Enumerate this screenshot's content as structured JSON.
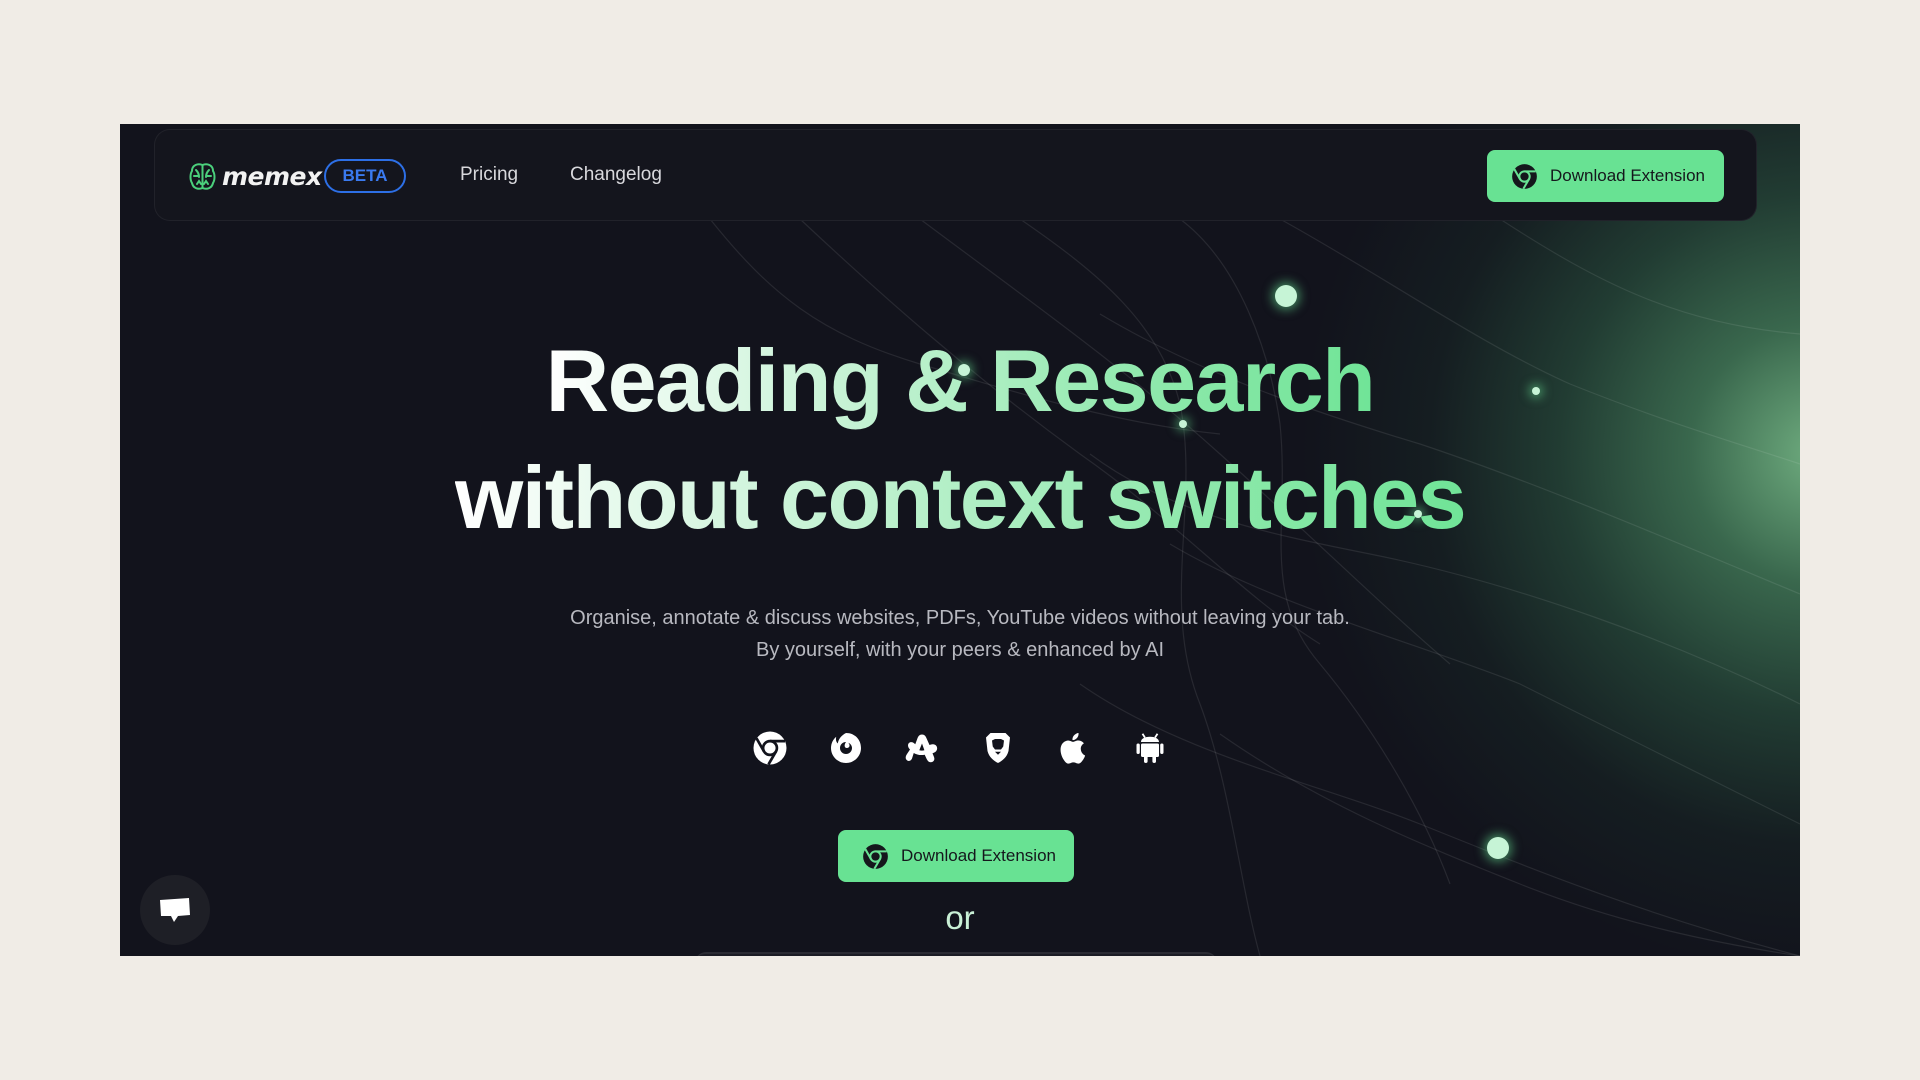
{
  "brand": {
    "name": "memex",
    "badge": "BETA",
    "accent": "#68e293",
    "badge_color": "#2d6fe6",
    "logo_icon": "brain-icon"
  },
  "nav": {
    "links": [
      {
        "label": "Pricing"
      },
      {
        "label": "Changelog"
      }
    ],
    "cta": {
      "label": "Download Extension",
      "icon": "chrome-icon"
    }
  },
  "hero": {
    "headline_line1": "Reading & Research",
    "headline_line2": "without context switches",
    "subtitle_line1": "Organise, annotate & discuss websites, PDFs, YouTube videos without leaving your tab.",
    "subtitle_line2": "By yourself, with your peers & enhanced by AI",
    "platforms": [
      {
        "name": "Chrome",
        "icon": "chrome-icon"
      },
      {
        "name": "Firefox",
        "icon": "firefox-icon"
      },
      {
        "name": "Arc",
        "icon": "arc-icon"
      },
      {
        "name": "Brave",
        "icon": "brave-icon"
      },
      {
        "name": "Safari / iOS",
        "icon": "apple-icon"
      },
      {
        "name": "Android",
        "icon": "android-icon"
      }
    ],
    "cta": {
      "label": "Download Extension",
      "icon": "chrome-icon"
    },
    "or_text": "or"
  },
  "chat_widget": {
    "icon": "chat-bubble-icon"
  }
}
